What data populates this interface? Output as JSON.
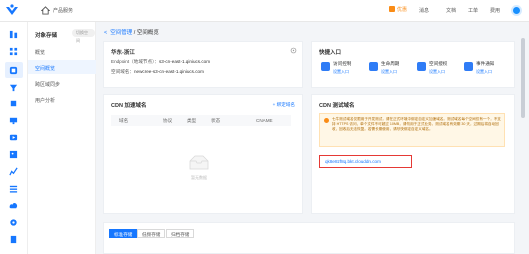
{
  "topbar": {
    "product_label": "产品服务",
    "promo": "优惠",
    "nav": [
      "消息",
      "文档",
      "工单",
      "费用"
    ]
  },
  "sidebar": {
    "title": "对象存储",
    "bucket_pill": "切换空间",
    "items": [
      {
        "label": "概览",
        "active": false
      },
      {
        "label": "空间概览",
        "active": true
      },
      {
        "label": "跨区域同步",
        "active": false
      },
      {
        "label": "用户分析",
        "active": false
      }
    ]
  },
  "breadcrumb": {
    "back": "<",
    "parent": "空间管理",
    "separator": "/",
    "current": "空间概览"
  },
  "region_card": {
    "title": "华东-浙江",
    "endpoint_label": "Endpoint（地域节点）：",
    "endpoint_value": "s3-cn-east-1.qiniucs.com",
    "space_domain_label": "空间域名：",
    "space_domain_value": "newcree-s3-cn-east-1.qiniucs.com"
  },
  "quick_entry": {
    "title": "快捷入口",
    "items": [
      {
        "label": "访问控制",
        "link": "设置入口",
        "color": "#2f7cf6"
      },
      {
        "label": "生命周期",
        "link": "设置入口",
        "color": "#2f7cf6"
      },
      {
        "label": "空间授权",
        "link": "设置入口",
        "color": "#2f7cf6"
      },
      {
        "label": "事件通知",
        "link": "设置入口",
        "color": "#2f7cf6"
      }
    ]
  },
  "cdn_accel": {
    "title": "CDN 加速域名",
    "add_link": "+ 绑定域名",
    "columns": [
      "域名",
      "协议",
      "类型",
      "状态",
      "CNAME"
    ],
    "empty_text": "暂无数据"
  },
  "cdn_test": {
    "title": "CDN 测试域名",
    "notice": "七牛测试域名仅限用于开发测试，请在正式环境中绑定自定义加速域名。测试域名每个空间仅有一个，不支持 HTTPS 访问，单个文件不可超过 10MB，请勿用于正式业务。测试域名有效期 30 天，过期后将自动回收，回收后无法恢复。若需长期使用，请尽快绑定自定义域名。",
    "domain": "qk8e8zf8q.bkt.clouddn.com"
  },
  "tabs": [
    {
      "label": "标准存储",
      "active": true
    },
    {
      "label": "低频存储",
      "active": false
    },
    {
      "label": "归档存储",
      "active": false
    }
  ]
}
